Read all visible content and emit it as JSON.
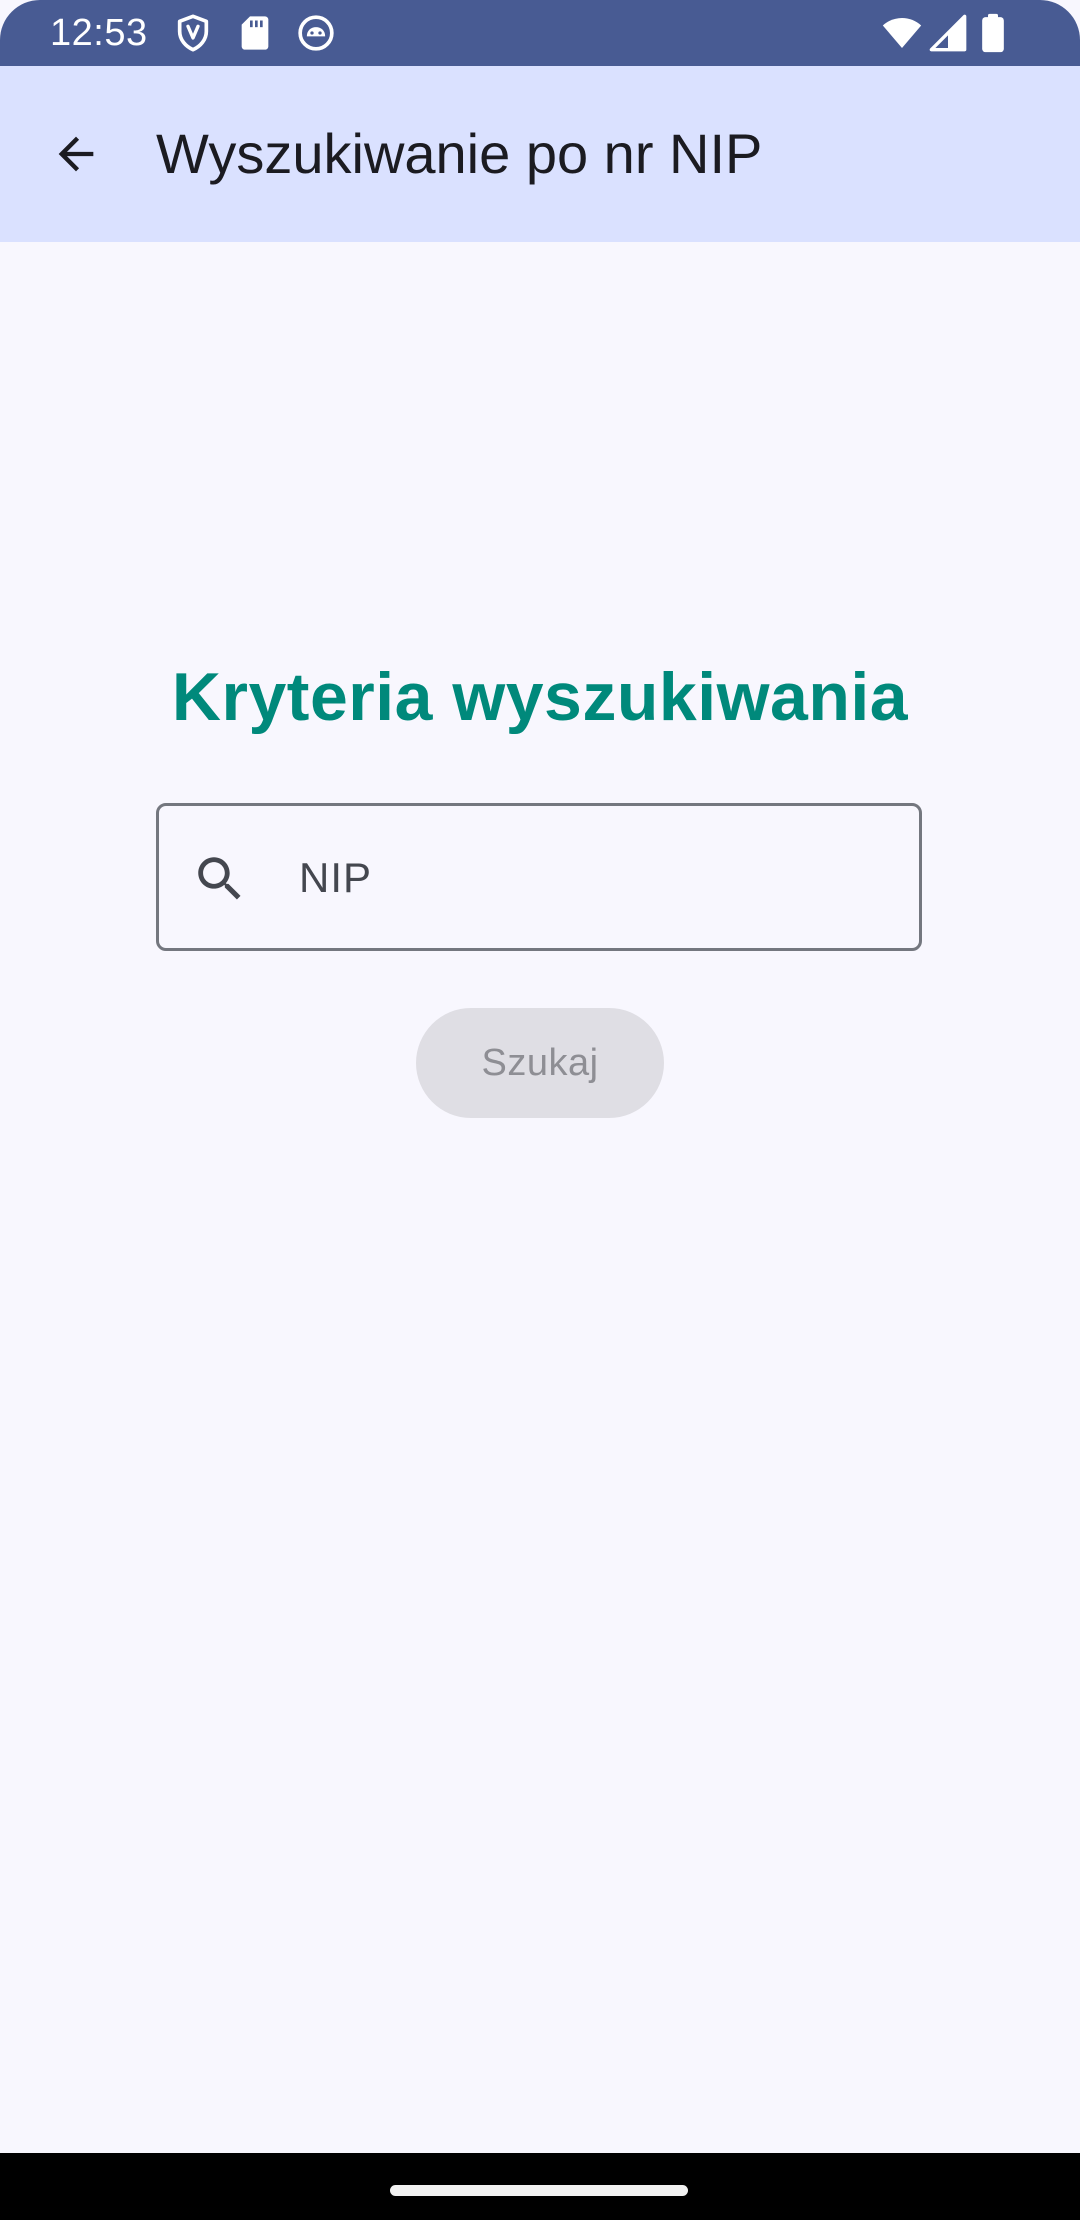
{
  "status_bar": {
    "time": "12:53",
    "background_color": "#485B93",
    "left_icons": [
      "vpn-shield-icon",
      "sd-card-icon",
      "android-debug-icon"
    ],
    "right_icons": [
      "wifi-icon",
      "cellular-signal-icon",
      "battery-icon"
    ]
  },
  "app_bar": {
    "title": "Wyszukiwanie po nr NIP",
    "back_icon": "arrow-back-icon",
    "background_color": "#DAE1FF"
  },
  "main": {
    "heading": "Kryteria wyszukiwania",
    "heading_color": "#00897B",
    "search_field": {
      "icon": "search-icon",
      "placeholder": "NIP",
      "value": ""
    },
    "search_button": {
      "label": "Szukaj",
      "enabled": false
    },
    "background_color": "#F8F7FE"
  },
  "nav_bar": {
    "indicator": "home-indicator"
  }
}
